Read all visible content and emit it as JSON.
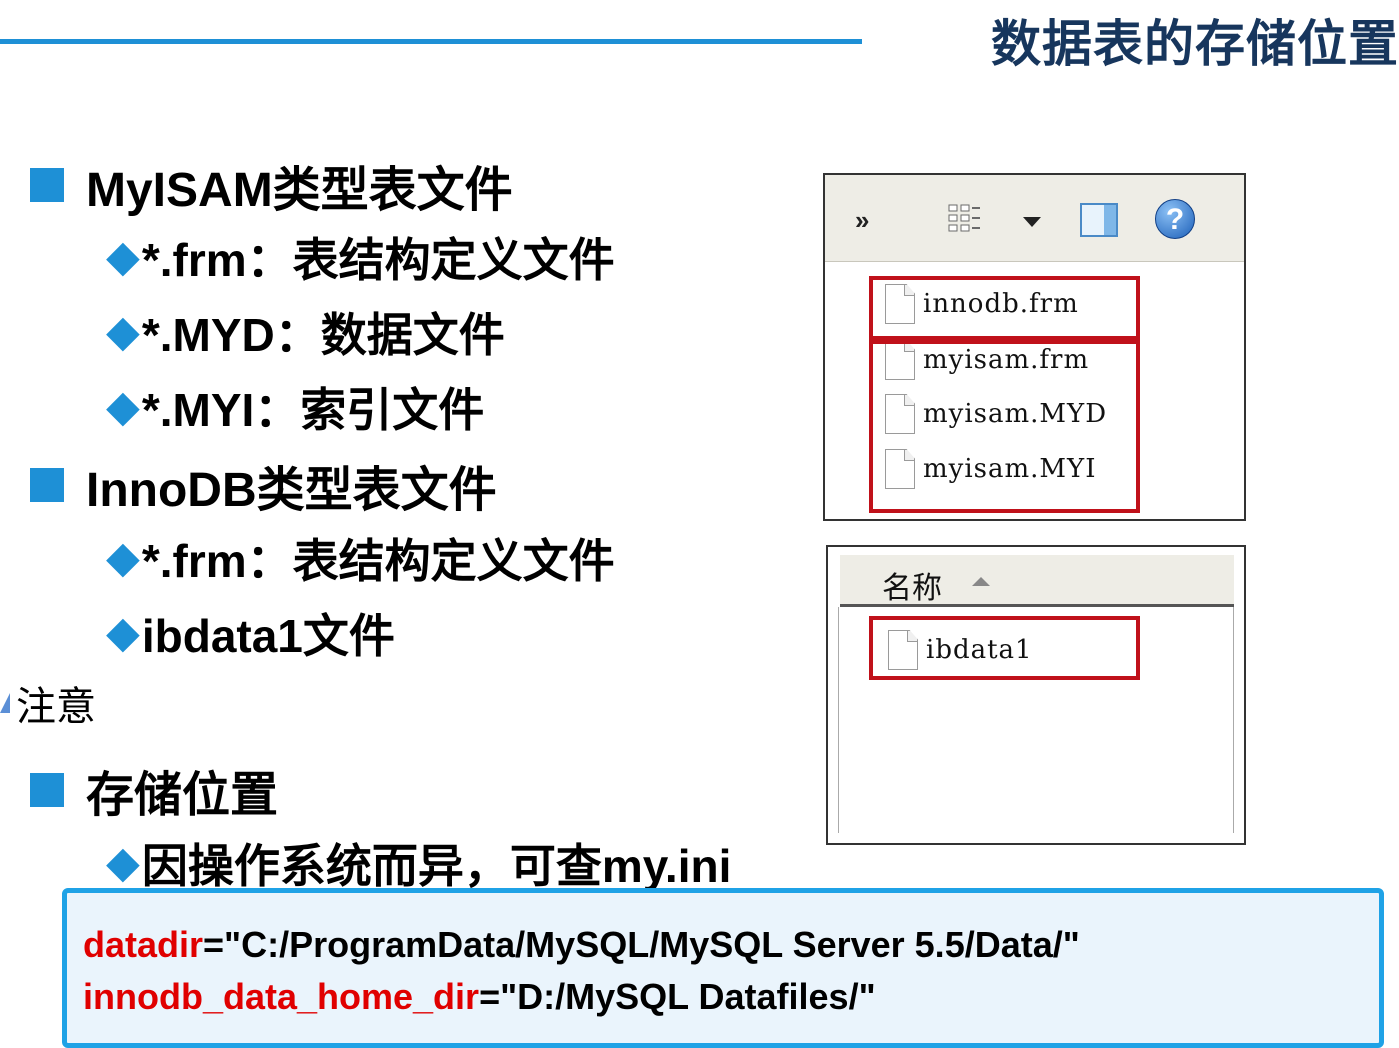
{
  "slide": {
    "title": "数据表的存储位置"
  },
  "bullets": {
    "myisam": {
      "heading": "MyISAM类型表文件",
      "items": [
        "*.frm：表结构定义文件",
        "*.MYD：数据文件",
        "*.MYI：索引文件"
      ]
    },
    "innodb": {
      "heading": "InnoDB类型表文件",
      "items": [
        "*.frm：表结构定义文件",
        "ibdata1文件"
      ]
    },
    "note": "注意",
    "storage": {
      "heading": "存储位置",
      "items": [
        "因操作系统而异，可查my.ini"
      ]
    }
  },
  "code": {
    "line1_key": "datadir",
    "line1_value": "=\"C:/ProgramData/MySQL/MySQL Server 5.5/Data/\"",
    "line2_key": "innodb_data_home_dir",
    "line2_value": "=\"D:/MySQL Datafiles/\""
  },
  "explorer1": {
    "toolbar": {
      "more_label": "»",
      "icons": [
        "chevron-more-icon",
        "view-options-icon",
        "dropdown-arrow-icon",
        "preview-pane-icon",
        "help-icon"
      ]
    },
    "files": [
      "innodb.frm",
      "myisam.frm",
      "myisam.MYD",
      "myisam.MYI"
    ]
  },
  "explorer2": {
    "column_header": "名称",
    "files": [
      "ibdata1"
    ]
  },
  "colors": {
    "accent_blue": "#1e90d6",
    "title_navy": "#17365d",
    "highlight_red": "#c0111a",
    "code_key_red": "#e00000"
  }
}
